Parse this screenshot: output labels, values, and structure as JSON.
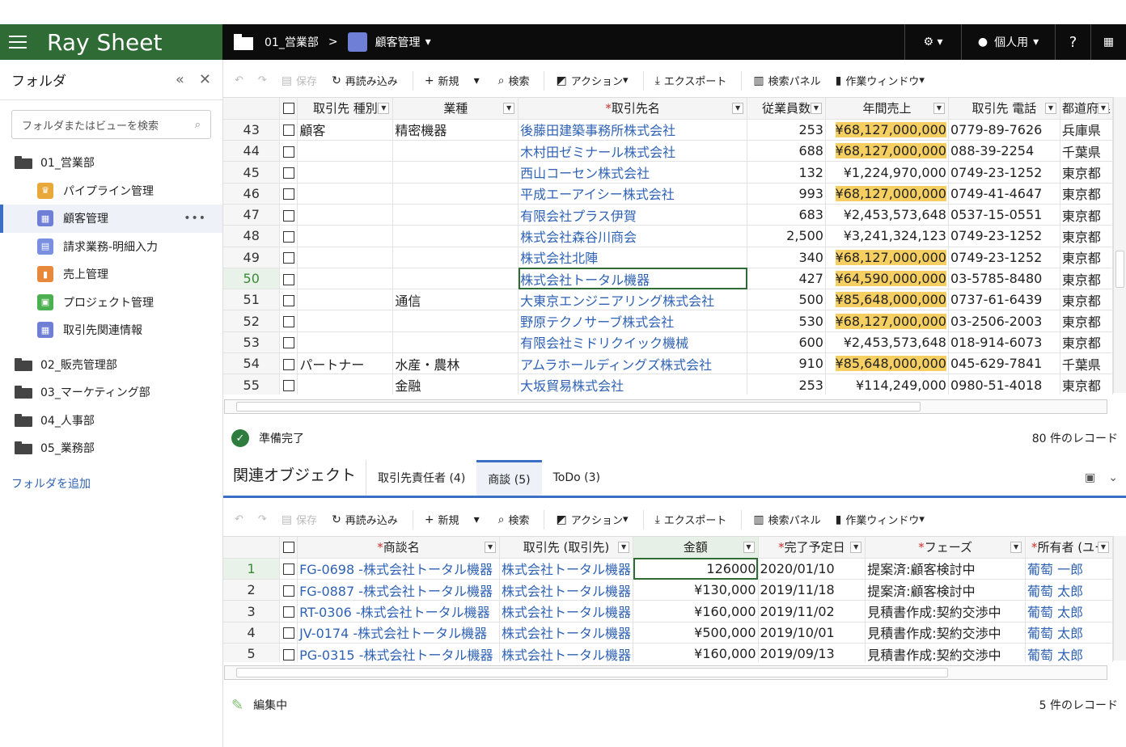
{
  "app": {
    "brand": "Ray Sheet"
  },
  "topbar": {
    "folder": "01_営業部",
    "sep": ">",
    "view": "顧客管理",
    "view_caret": "▾",
    "settings": "⚙ ▾",
    "user": "個人用",
    "user_caret": "▾",
    "help": "?",
    "layout": "▦"
  },
  "sidebar": {
    "title": "フォルダ",
    "collapse": "«",
    "close": "✕",
    "search_placeholder": "フォルダまたはビューを検索",
    "folders_top": "01_営業部",
    "views": [
      {
        "label": "パイプライン管理",
        "color": "#e9a93a",
        "glyph": "♛"
      },
      {
        "label": "顧客管理",
        "color": "#6f7fd6",
        "glyph": "▦"
      },
      {
        "label": "請求業務-明細入力",
        "color": "#7a8fe0",
        "glyph": "▤"
      },
      {
        "label": "売上管理",
        "color": "#e8883a",
        "glyph": "▮"
      },
      {
        "label": "プロジェクト管理",
        "color": "#4caf50",
        "glyph": "▣"
      },
      {
        "label": "取引先関連情報",
        "color": "#6f7fd6",
        "glyph": "▦"
      }
    ],
    "more": "•••",
    "folders": [
      "02_販売管理部",
      "03_マーケティング部",
      "04_人事部",
      "05_業務部"
    ],
    "add_folder": "フォルダを追加"
  },
  "toolbar": {
    "undo": "↶",
    "redo": "↷",
    "save": "保存",
    "reload": "再読み込み",
    "new": "新規",
    "search": "検索",
    "action": "アクション",
    "export": "エクスポート",
    "search_panel": "検索パネル",
    "work_window": "作業ウィンドウ"
  },
  "main_grid": {
    "headers": [
      "取引先 種別",
      "業種",
      "*取引先名",
      "従業員数",
      "年間売上",
      "取引先 電話",
      "都道府県"
    ],
    "rows": [
      {
        "n": "43",
        "type": "顧客",
        "ind": "精密機器",
        "name": "後藤田建築事務所株式会社",
        "emp": "253",
        "sales": "¥68,127,000,000",
        "phone": "0779-89-7626",
        "pref": "兵庫県",
        "hl": true
      },
      {
        "n": "44",
        "type": "",
        "ind": "",
        "name": "木村田ゼミナール株式会社",
        "emp": "688",
        "sales": "¥68,127,000,000",
        "phone": "088-39-2254",
        "pref": "千葉県",
        "hl": true
      },
      {
        "n": "45",
        "type": "",
        "ind": "",
        "name": "西山コーセン株式会社",
        "emp": "132",
        "sales": "¥1,224,970,000",
        "phone": "0749-23-1252",
        "pref": "東京都",
        "hl": false
      },
      {
        "n": "46",
        "type": "",
        "ind": "",
        "name": "平成エーアイシー株式会社",
        "emp": "993",
        "sales": "¥68,127,000,000",
        "phone": "0749-41-4647",
        "pref": "東京都",
        "hl": true
      },
      {
        "n": "47",
        "type": "",
        "ind": "",
        "name": "有限会社プラス伊賀",
        "emp": "683",
        "sales": "¥2,453,573,648",
        "phone": "0537-15-0551",
        "pref": "東京都",
        "hl": false
      },
      {
        "n": "48",
        "type": "",
        "ind": "",
        "name": "株式会社森谷川商会",
        "emp": "2,500",
        "sales": "¥3,241,324,123",
        "phone": "0749-23-1252",
        "pref": "東京都",
        "hl": false
      },
      {
        "n": "49",
        "type": "",
        "ind": "",
        "name": "株式会社北陣",
        "emp": "340",
        "sales": "¥68,127,000,000",
        "phone": "0749-23-1252",
        "pref": "東京都",
        "hl": true
      },
      {
        "n": "50",
        "type": "",
        "ind": "",
        "name": "株式会社トータル機器",
        "emp": "427",
        "sales": "¥64,590,000,000",
        "phone": "03-5785-8480",
        "pref": "東京都",
        "hl": true
      },
      {
        "n": "51",
        "type": "",
        "ind": "通信",
        "name": "大東京エンジニアリング株式会社",
        "emp": "500",
        "sales": "¥85,648,000,000",
        "phone": "0737-61-6439",
        "pref": "東京都",
        "hl": true
      },
      {
        "n": "52",
        "type": "",
        "ind": "",
        "name": "野原テクノサーブ株式会社",
        "emp": "530",
        "sales": "¥68,127,000,000",
        "phone": "03-2506-2003",
        "pref": "東京都",
        "hl": true
      },
      {
        "n": "53",
        "type": "",
        "ind": "",
        "name": "有限会社ミドリクイック機械",
        "emp": "600",
        "sales": "¥2,453,573,648",
        "phone": "018-914-6073",
        "pref": "東京都",
        "hl": false
      },
      {
        "n": "54",
        "type": "パートナー",
        "ind": "水産・農林",
        "name": "アムラホールディングズ株式会社",
        "emp": "910",
        "sales": "¥85,648,000,000",
        "phone": "045-629-7841",
        "pref": "千葉県",
        "hl": true
      },
      {
        "n": "55",
        "type": "",
        "ind": "金融",
        "name": "大坂貿易株式会社",
        "emp": "253",
        "sales": "¥114,249,000",
        "phone": "0980-51-4018",
        "pref": "東京都",
        "hl": false
      }
    ]
  },
  "status_main": {
    "text": "準備完了",
    "count": "80 件のレコード"
  },
  "related": {
    "title": "関連オブジェクト",
    "tabs": [
      "取引先責任者 (4)",
      "商談 (5)",
      "ToDo (3)"
    ]
  },
  "sub_grid": {
    "headers": [
      "*商談名",
      "取引先 (取引先)",
      "金額",
      "*完了予定日",
      "*フェーズ",
      "*所有者 (ユー"
    ],
    "rows": [
      {
        "n": "1",
        "name": "FG-0698 -株式会社トータル機器",
        "acc": "株式会社トータル機器",
        "amt": "126000",
        "date": "2020/01/10",
        "phase": "提案済:顧客検討中",
        "owner": "葡萄 一郎"
      },
      {
        "n": "2",
        "name": "FG-0887 -株式会社トータル機器",
        "acc": "株式会社トータル機器",
        "amt": "¥130,000",
        "date": "2019/11/18",
        "phase": "提案済:顧客検討中",
        "owner": "葡萄 太郎"
      },
      {
        "n": "3",
        "name": "RT-0306 -株式会社トータル機器",
        "acc": "株式会社トータル機器",
        "amt": "¥160,000",
        "date": "2019/11/02",
        "phase": "見積書作成:契約交渉中",
        "owner": "葡萄 太郎"
      },
      {
        "n": "4",
        "name": "JV-0174 -株式会社トータル機器",
        "acc": "株式会社トータル機器",
        "amt": "¥500,000",
        "date": "2019/10/01",
        "phase": "見積書作成:契約交渉中",
        "owner": "葡萄 太郎"
      },
      {
        "n": "5",
        "name": "PG-0315 -株式会社トータル機器",
        "acc": "株式会社トータル機器",
        "amt": "¥160,000",
        "date": "2019/09/13",
        "phase": "見積書作成:契約交渉中",
        "owner": "葡萄 太郎"
      }
    ]
  },
  "status_sub": {
    "text": "編集中",
    "count": "5 件のレコード"
  }
}
